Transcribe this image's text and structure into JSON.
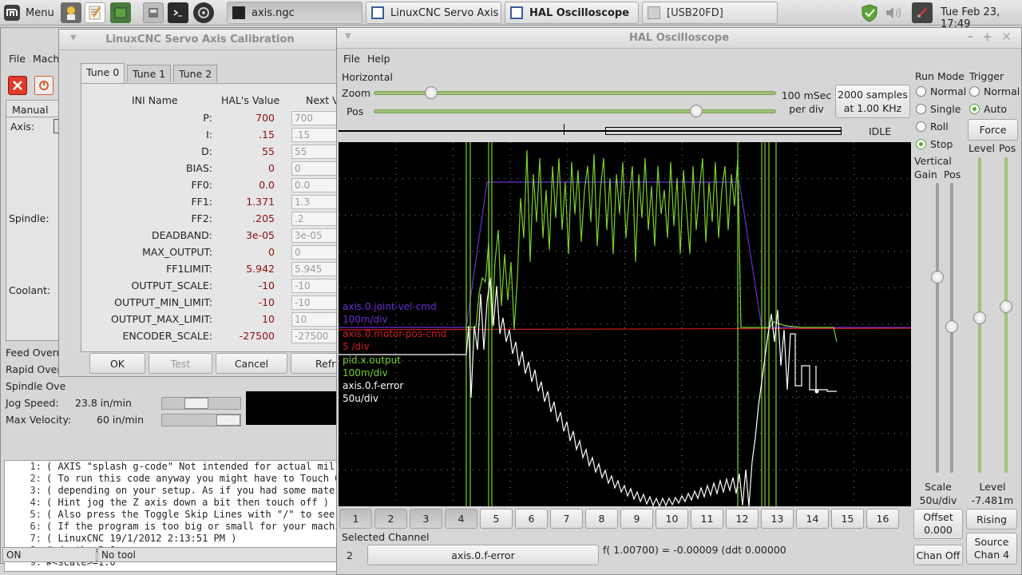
{
  "taskbar": {
    "menu_label": "Menu",
    "tasks": [
      "axis.ngc",
      "LinuxCNC Servo Axis ...",
      "HAL Oscilloscope",
      "[USB20FD]"
    ],
    "clock": "Tue Feb 23, 17:49"
  },
  "axis": {
    "menu": [
      "File",
      "Mach"
    ],
    "manual_tab": "Manual Co",
    "axis_label": "Axis:",
    "spindle_label": "Spindle:",
    "coolant_label": "Coolant:",
    "overrides": [
      "Feed Overri",
      "Rapid Overr",
      "Spindle Ove"
    ],
    "jog_speed_label": "Jog Speed:",
    "jog_speed_value": "23.8 in/min",
    "max_velocity_label": "Max Velocity:",
    "max_velocity_value": "60 in/min",
    "gcode_lines": [
      {
        "n": "1:",
        "t": "( AXIS \"splash g-code\" Not intended for actual mill"
      },
      {
        "n": "2:",
        "t": "( To run this code anyway you might have to Touch O"
      },
      {
        "n": "3:",
        "t": "( depending on your setup. As if you had some mater"
      },
      {
        "n": "4:",
        "t": "( Hint jog the Z axis down a bit then touch off )"
      },
      {
        "n": "5:",
        "t": "( Also press the Toggle Skip Lines with \"/\" to see"
      },
      {
        "n": "6:",
        "t": "( If the program is too big or small for your machi"
      },
      {
        "n": "7:",
        "t": "( LinuxCNC 19/1/2012 2:13:51 PM )"
      },
      {
        "n": "8:",
        "t": "#<depth>=2.0"
      },
      {
        "n": "9:",
        "t": "#<scale>=1.0"
      }
    ],
    "status_state": "ON",
    "status_tool": "No tool"
  },
  "calibration": {
    "title": "LinuxCNC Servo Axis Calibration",
    "tabs": [
      "Tune 0",
      "Tune 1",
      "Tune 2"
    ],
    "col_ini": "INI Name",
    "col_hal": "HAL's Value",
    "col_next": "Next V",
    "rows": [
      {
        "name": "P:",
        "hal": "700",
        "next": "700"
      },
      {
        "name": "I:",
        "hal": ".15",
        "next": ".15"
      },
      {
        "name": "D:",
        "hal": "55",
        "next": "55"
      },
      {
        "name": "BIAS:",
        "hal": "0",
        "next": "0"
      },
      {
        "name": "FF0:",
        "hal": "0.0",
        "next": "0.0"
      },
      {
        "name": "FF1:",
        "hal": "1.371",
        "next": "1.3"
      },
      {
        "name": "FF2:",
        "hal": ".205",
        "next": ".2"
      },
      {
        "name": "DEADBAND:",
        "hal": "3e-05",
        "next": "3e-05"
      },
      {
        "name": "MAX_OUTPUT:",
        "hal": "0",
        "next": "0"
      },
      {
        "name": "FF1LIMIT:",
        "hal": "5.942",
        "next": "5.945"
      },
      {
        "name": "OUTPUT_SCALE:",
        "hal": "-10",
        "next": "-10"
      },
      {
        "name": "OUTPUT_MIN_LIMIT:",
        "hal": "-10",
        "next": "-10"
      },
      {
        "name": "OUTPUT_MAX_LIMIT:",
        "hal": "10",
        "next": "10"
      },
      {
        "name": "ENCODER_SCALE:",
        "hal": "-27500",
        "next": "-27500"
      }
    ],
    "buttons": {
      "ok": "OK",
      "test": "Test",
      "cancel": "Cancel",
      "refresh": "Refre"
    }
  },
  "scope": {
    "title": "HAL Oscilloscope",
    "menu": [
      "File",
      "Help"
    ],
    "horizontal_label": "Horizontal",
    "zoom_label": "Zoom",
    "pos_label": "Pos",
    "zoom_value_line1": "100 mSec",
    "zoom_value_line2": "per div",
    "zoom_level": 0.13,
    "pos_level": 0.81,
    "samples_line1": "2000 samples",
    "samples_line2": "at 1.00 KHz",
    "state": "IDLE",
    "run_mode_label": "Run Mode",
    "run_modes": [
      "Normal",
      "Single",
      "Roll",
      "Stop"
    ],
    "run_mode_selected": "Stop",
    "trigger_label": "Trigger",
    "trigger_modes": [
      "Normal",
      "Auto"
    ],
    "trigger_selected": "Auto",
    "force_label": "Force",
    "vertical_label": "Vertical",
    "gain_label": "Gain",
    "vpos_label": "Pos",
    "level_label": "Level",
    "tpos_label": "Pos",
    "scale_label": "Scale",
    "scale_value": "50u/div",
    "level_label2": "Level",
    "level_value": "-7.481m",
    "offset_label": "Offset",
    "offset_value": "0.000",
    "rising_label": "Rising",
    "chan_off_label": "Chan Off",
    "source_label": "Source",
    "source_value": "Chan 4",
    "channels": [
      "1",
      "2",
      "3",
      "4",
      "5",
      "6",
      "7",
      "8",
      "9",
      "10",
      "11",
      "12",
      "13",
      "14",
      "15",
      "16"
    ],
    "channels_on": [
      1,
      2,
      3,
      4
    ],
    "selected_channel_label": "Selected Channel",
    "selected_channel_num": "2",
    "selected_channel_name": "axis.0.f-error",
    "readout": "f( 1.00700) = -0.00009 (ddt  0.00000",
    "traces": [
      {
        "name": "axis.0.joint-vel-cmd",
        "scale": "100m/div",
        "color": "#6a2fd6"
      },
      {
        "name": "axis.0.motor-pos-cmd",
        "scale": "5 /div",
        "color": "#d21e1e"
      },
      {
        "name": "pid.x.output",
        "scale": "100m/div",
        "color": "#7ad12a"
      },
      {
        "name": "axis.0.f-error",
        "scale": "50u/div",
        "color": "#ffffff"
      }
    ]
  }
}
